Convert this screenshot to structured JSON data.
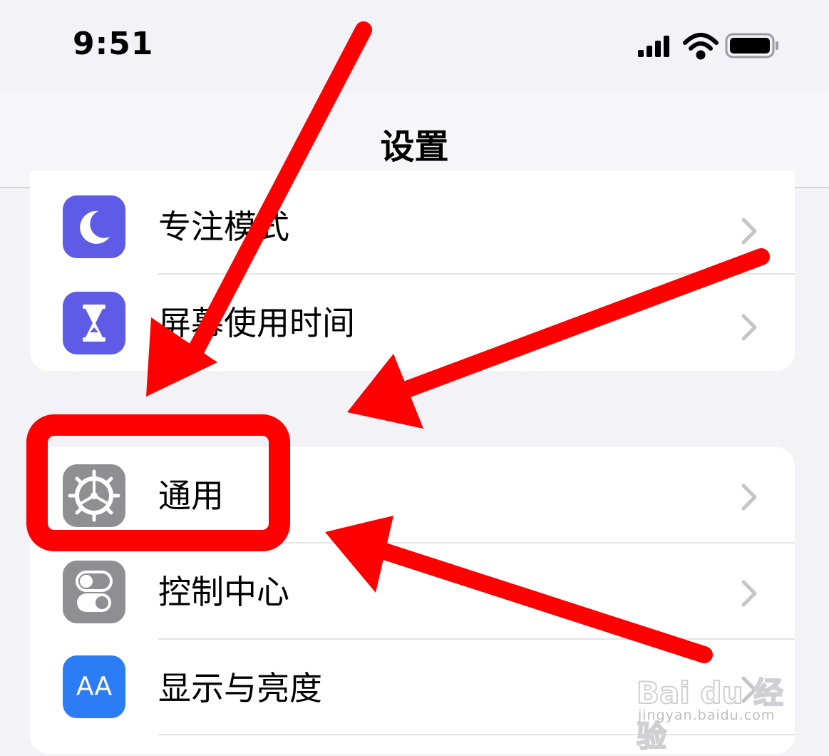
{
  "status_bar": {
    "time": "9:51",
    "icons": [
      "signal-icon",
      "wifi-icon",
      "battery-icon"
    ]
  },
  "nav": {
    "title": "设置"
  },
  "groups": [
    {
      "items": [
        {
          "label": "专注模式",
          "icon": "moon-icon",
          "icon_color": "#5e5ce6"
        },
        {
          "label": "屏幕使用时间",
          "icon": "hourglass-icon",
          "icon_color": "#5e5ce6"
        }
      ]
    },
    {
      "items": [
        {
          "label": "通用",
          "icon": "gear-icon",
          "icon_color": "#8e8e93"
        },
        {
          "label": "控制中心",
          "icon": "toggles-icon",
          "icon_color": "#8e8e93"
        },
        {
          "label": "显示与亮度",
          "icon": "display-icon",
          "icon_color": "#2c7cf6",
          "icon_text": "AA"
        }
      ]
    }
  ],
  "annotation": {
    "color": "#ff0000",
    "highlight_target": "通用"
  },
  "watermark": {
    "logo": "Bai du 经验",
    "url": "jingyan.baidu.com"
  }
}
